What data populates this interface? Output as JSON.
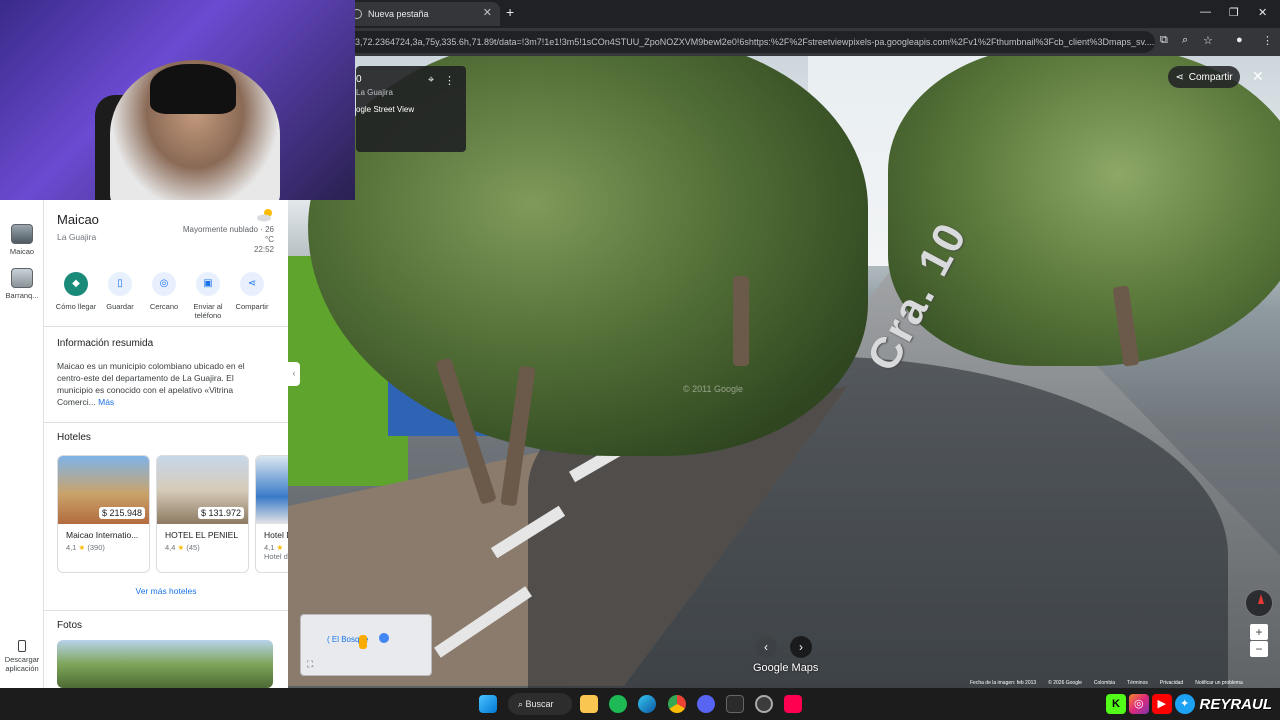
{
  "browser": {
    "tab_title": "Nueva pestaña",
    "url": "3,72.2364724,3a,75y,335.6h,71.89t/data=!3m7!1e1!3m5!1sCOn4STUU_ZpoNOZXVM9bewl2e0!6shttps:%2F%2Fstreetviewpixels-pa.googleapis.com%2Fv1%2Fthumbnail%3Fcb_client%3Dmaps_sv...."
  },
  "streetview": {
    "info_title": "0",
    "info_subtitle": "La Guajira",
    "info_source": "ogle Street View",
    "share_label": "Compartir",
    "road_label": "Cra. 10",
    "watermark": "© 2011 Google",
    "logo": "Google Maps",
    "minimap_label": "( El Bosque",
    "footer": [
      "Fecha de la imagen: feb 2013",
      "© 2026 Google",
      "Colombia",
      "Términos",
      "Privacidad",
      "Notificar un problema"
    ]
  },
  "rail": {
    "items": [
      {
        "label": "Maicao"
      },
      {
        "label": "Barranq..."
      }
    ],
    "download_label": "Descargar aplicación"
  },
  "place": {
    "name": "Maicao",
    "region": "La Guajira",
    "weather": "Mayormente nublado · 26 °C",
    "time": "22:52"
  },
  "actions": [
    {
      "label": "Cómo llegar",
      "icon": "directions-icon"
    },
    {
      "label": "Guardar",
      "icon": "bookmark-icon"
    },
    {
      "label": "Cercano",
      "icon": "nearby-icon"
    },
    {
      "label": "Enviar al teléfono",
      "icon": "phone-icon"
    },
    {
      "label": "Compartir",
      "icon": "share-icon"
    }
  ],
  "summary": {
    "title": "Información resumida",
    "text": "Maicao es un municipio colombiano ubicado en el centro-este del departamento de La Guajira. El municipio es conocido con el apelativo «Vitrina Comerci...",
    "more": "Más"
  },
  "hotels": {
    "title": "Hoteles",
    "items": [
      {
        "price": "$ 215.948",
        "name": "Maicao Internatio...",
        "rating": "4,1",
        "reviews": "(390)"
      },
      {
        "price": "$ 131.972",
        "name": "HOTEL EL PENIEL",
        "rating": "4,4",
        "reviews": "(45)"
      },
      {
        "price": "",
        "name": "Hotel Di...",
        "rating": "4,1",
        "reviews": "Hotel d..."
      }
    ],
    "see_more": "Ver más hoteles"
  },
  "photos": {
    "title": "Fotos"
  },
  "taskbar": {
    "search_label": "Buscar"
  },
  "brand": {
    "text": "REYRAUL"
  },
  "colors": {
    "accent": "#1a73e8",
    "primary_action": "#1a8a7a"
  }
}
